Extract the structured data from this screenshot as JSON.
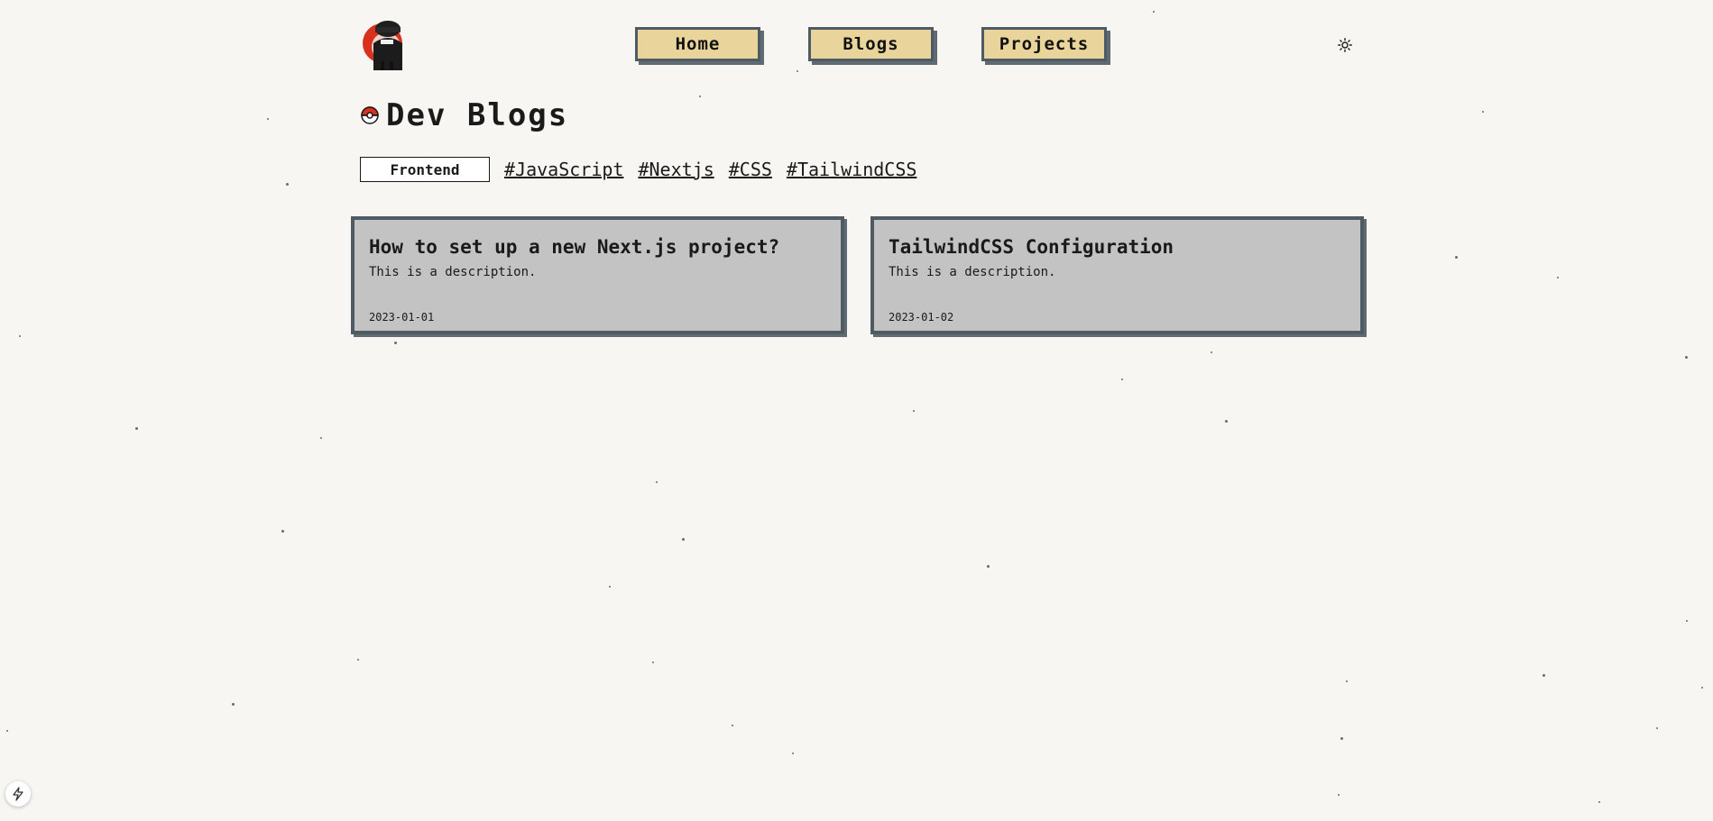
{
  "nav": {
    "items": [
      {
        "label": "Home"
      },
      {
        "label": "Blogs"
      },
      {
        "label": "Projects"
      }
    ]
  },
  "page": {
    "title": "Dev Blogs"
  },
  "filters": {
    "category": "Frontend",
    "tags": [
      "#JavaScript",
      "#Nextjs",
      "#CSS",
      "#TailwindCSS"
    ]
  },
  "posts": [
    {
      "title": "How to set up a new Next.js project?",
      "description": "This is a description.",
      "date": "2023-01-01"
    },
    {
      "title": "TailwindCSS Configuration",
      "description": "This is a description.",
      "date": "2023-01-02"
    }
  ],
  "colors": {
    "background": "#f7f6f3",
    "nav_button": "#e9d59c",
    "card": "#c3c3c3",
    "border": "#4f5b63"
  }
}
